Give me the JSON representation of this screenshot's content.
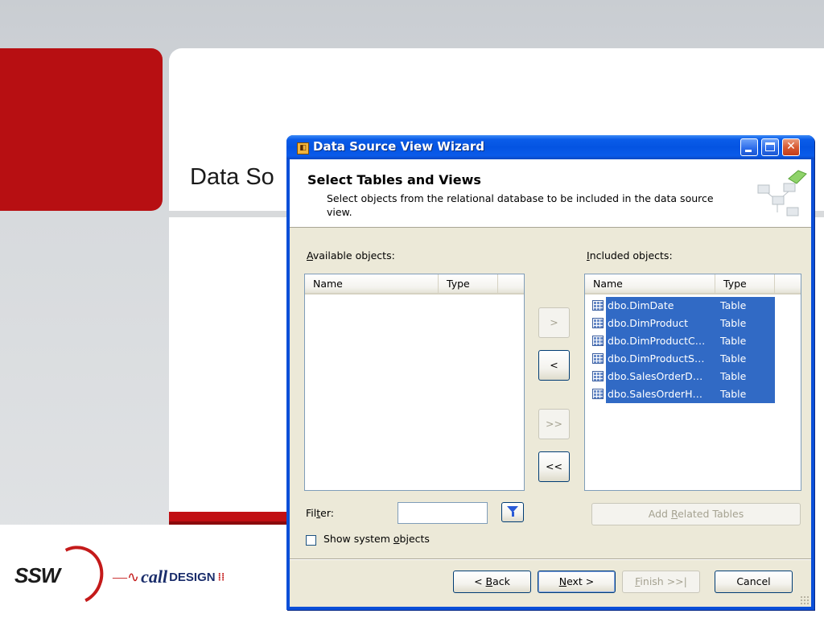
{
  "slide": {
    "title": "Data So",
    "logos": {
      "ssw": "SSW",
      "call_prefix": "call",
      "call_suffix": "DESIGN"
    }
  },
  "window": {
    "title": "Data Source View Wizard",
    "controls": [
      "minimize",
      "maximize",
      "close"
    ]
  },
  "header": {
    "title": "Select Tables and Views",
    "description": "Select objects from the relational database to be included in the data source view."
  },
  "available": {
    "label_prefix": "A",
    "label_rest": "vailable objects:",
    "columns": [
      "Name",
      "Type"
    ],
    "rows": []
  },
  "included": {
    "label_prefix": "I",
    "label_rest": "ncluded objects:",
    "columns": [
      "Name",
      "Type"
    ],
    "rows": [
      {
        "name": "dbo.DimDate",
        "type": "Table"
      },
      {
        "name": "dbo.DimProduct",
        "type": "Table"
      },
      {
        "name": "dbo.DimProductC…",
        "type": "Table"
      },
      {
        "name": "dbo.DimProductS…",
        "type": "Table"
      },
      {
        "name": "dbo.SalesOrderD…",
        "type": "Table"
      },
      {
        "name": "dbo.SalesOrderH…",
        "type": "Table"
      }
    ]
  },
  "transfer": {
    "add": ">",
    "remove": "<",
    "add_all": ">>",
    "remove_all": "<<"
  },
  "filter": {
    "label_a": "Fil",
    "label_ul": "t",
    "label_b": "er:",
    "value": "",
    "show_system_a": "Show system ",
    "show_system_ul": "o",
    "show_system_b": "bjects",
    "add_related_a": "Add ",
    "add_related_ul": "R",
    "add_related_b": "elated Tables"
  },
  "footer": {
    "back_a": "< ",
    "back_ul": "B",
    "back_b": "ack",
    "next_ul": "N",
    "next_b": "ext >",
    "finish_ul": "F",
    "finish_b": "inish >>|",
    "cancel": "Cancel"
  },
  "colors": {
    "selection": "#316ac5",
    "titlebar": "#0454e2",
    "slide_red": "#b70f12"
  }
}
